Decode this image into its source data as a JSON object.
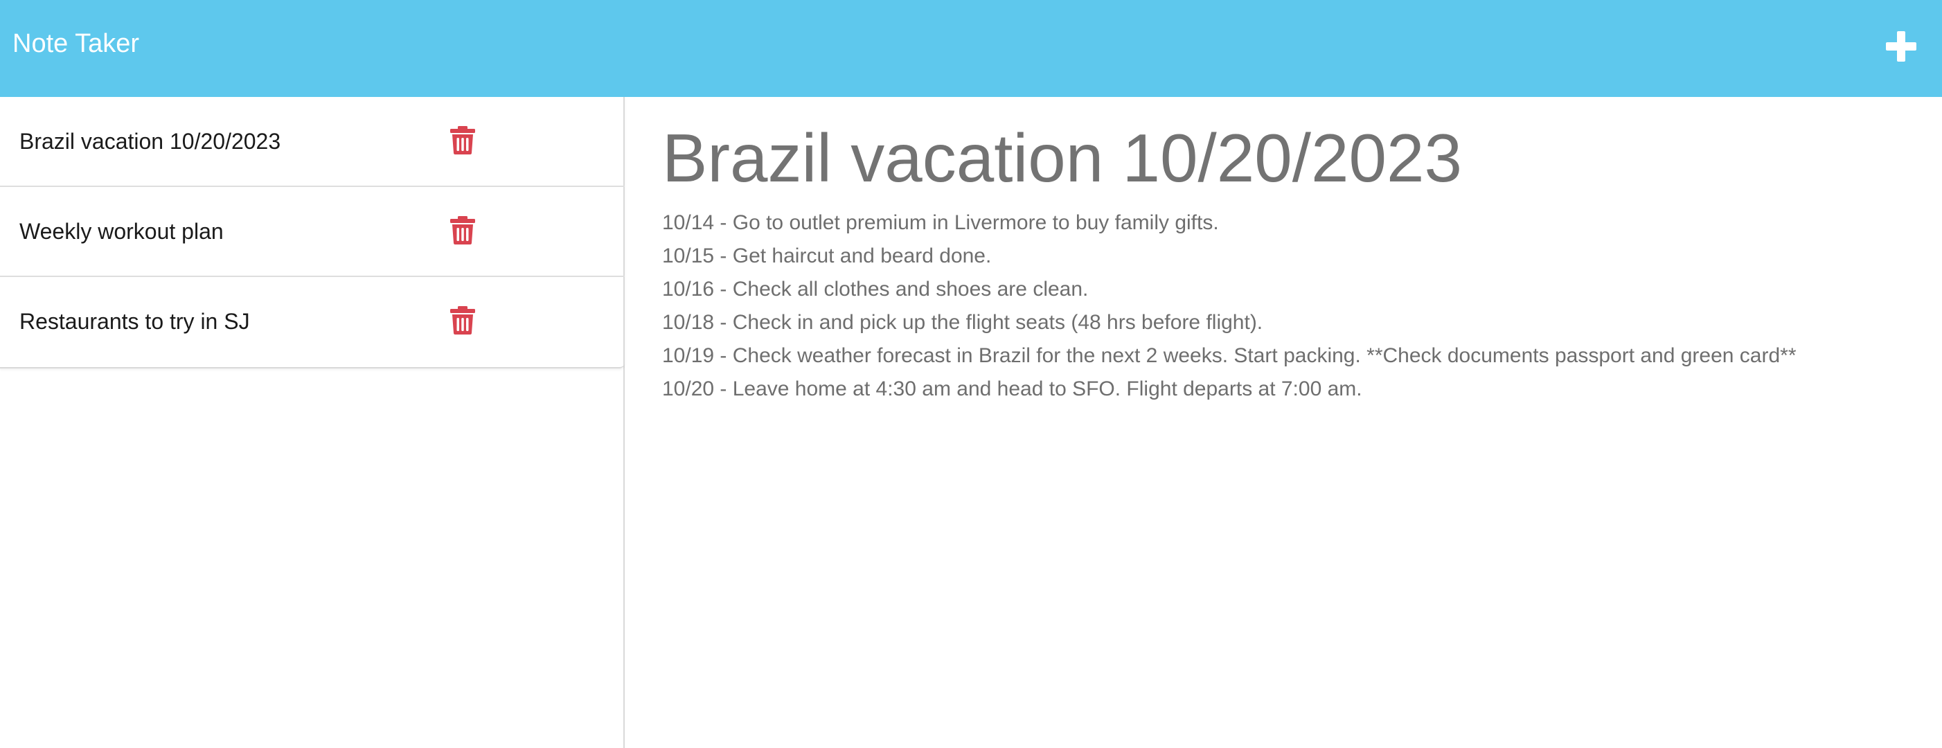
{
  "app": {
    "title": "Note Taker",
    "new_note_icon": "plus-icon",
    "header_color": "#5ec8ed"
  },
  "notes": [
    {
      "title": "Brazil vacation 10/20/2023",
      "delete_icon": "trash-icon"
    },
    {
      "title": "Weekly workout plan",
      "delete_icon": "trash-icon"
    },
    {
      "title": "Restaurants to try in SJ",
      "delete_icon": "trash-icon"
    }
  ],
  "active_note": {
    "title": "Brazil vacation 10/20/2023",
    "body": "10/14 - Go to outlet premium in Livermore to buy family gifts.\n10/15 - Get haircut and beard done.\n10/16 - Check all clothes and shoes are clean.\n10/18 - Check in and pick up the flight seats (48 hrs before flight).\n10/19 - Check weather forecast in Brazil for the next 2 weeks. Start packing. **Check documents passport and green card**\n10/20 - Leave home at 4:30 am and head to SFO. Flight departs at 7:00 am."
  },
  "colors": {
    "delete_icon": "#d9434f",
    "title_text": "#737373",
    "body_text": "#6e6e6e"
  }
}
